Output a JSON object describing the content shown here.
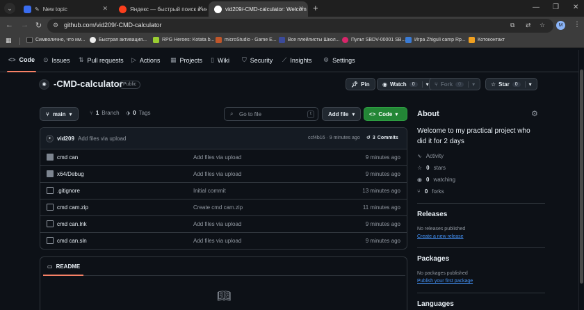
{
  "browser": {
    "tabs": [
      {
        "label": "New topic",
        "favicon_color": "#3a6df0"
      },
      {
        "label": "Яндекс — быстрый поиск в инте",
        "favicon_color": "#fc3f1d"
      },
      {
        "label": "vid209/-CMD-calculator: Welcom",
        "favicon_color": "#ffffff"
      }
    ],
    "url": "github.com/vid209/-CMD-calculator",
    "profile_initial": "M",
    "bookmarks": [
      "Символично, что им...",
      "Быстрая активация...",
      "RPG Heroes: Kotata b...",
      "microStudio - Game E...",
      "Все плейлисты Школ...",
      "Пульт SBDV-00001 SB...",
      "Игра Zhiguli camp Rp...",
      "Котоконтакт"
    ]
  },
  "repo_nav": {
    "items": [
      "Code",
      "Issues",
      "Pull requests",
      "Actions",
      "Projects",
      "Wiki",
      "Security",
      "Insights",
      "Settings"
    ]
  },
  "repo": {
    "name": "-CMD-calculator",
    "visibility": "Public",
    "pin_label": "Pin",
    "watch_label": "Watch",
    "watch_count": "0",
    "fork_label": "Fork",
    "fork_count": "0",
    "star_label": "Star",
    "star_count": "0"
  },
  "toolbar": {
    "branch": "main",
    "branch_count": "1",
    "branch_word": "Branch",
    "tag_count": "0",
    "tag_word": "Tags",
    "search_placeholder": "Go to file",
    "search_kbd": "t",
    "add_file_label": "Add file",
    "code_label": "Code"
  },
  "last_commit": {
    "author": "vid209",
    "message": "Add files via upload",
    "hash_time": "ccf4b16 · 9 minutes ago",
    "commits_count": "3",
    "commits_word": "Commits"
  },
  "files": [
    {
      "name": "cmd can",
      "type": "folder",
      "message": "Add files via upload",
      "time": "9 minutes ago"
    },
    {
      "name": "x64/Debug",
      "type": "folder",
      "message": "Add files via upload",
      "time": "9 minutes ago"
    },
    {
      "name": ".gitignore",
      "type": "file",
      "message": "Initial commit",
      "time": "13 minutes ago"
    },
    {
      "name": "cmd cam.zip",
      "type": "file",
      "message": "Create cmd cam.zip",
      "time": "11 minutes ago"
    },
    {
      "name": "cmd can.lnk",
      "type": "file",
      "message": "Add files via upload",
      "time": "9 minutes ago"
    },
    {
      "name": "cmd can.sln",
      "type": "file",
      "message": "Add files via upload",
      "time": "9 minutes ago"
    }
  ],
  "readme": {
    "title": "README"
  },
  "sidebar": {
    "about_title": "About",
    "description": "Welcome to my practical project who did it for 2 days",
    "activity": "Activity",
    "stars_count": "0",
    "stars_word": "stars",
    "watching_count": "0",
    "watching_word": "watching",
    "forks_count": "0",
    "forks_word": "forks",
    "releases_title": "Releases",
    "releases_note": "No releases published",
    "releases_link": "Create a new release",
    "packages_title": "Packages",
    "packages_note": "No packages published",
    "packages_link": "Publish your first package",
    "languages_title": "Languages"
  },
  "colors": {
    "accent_underline": "#f78166",
    "code_button": "#238636",
    "link": "#4493f8",
    "background": "#0d1117"
  }
}
